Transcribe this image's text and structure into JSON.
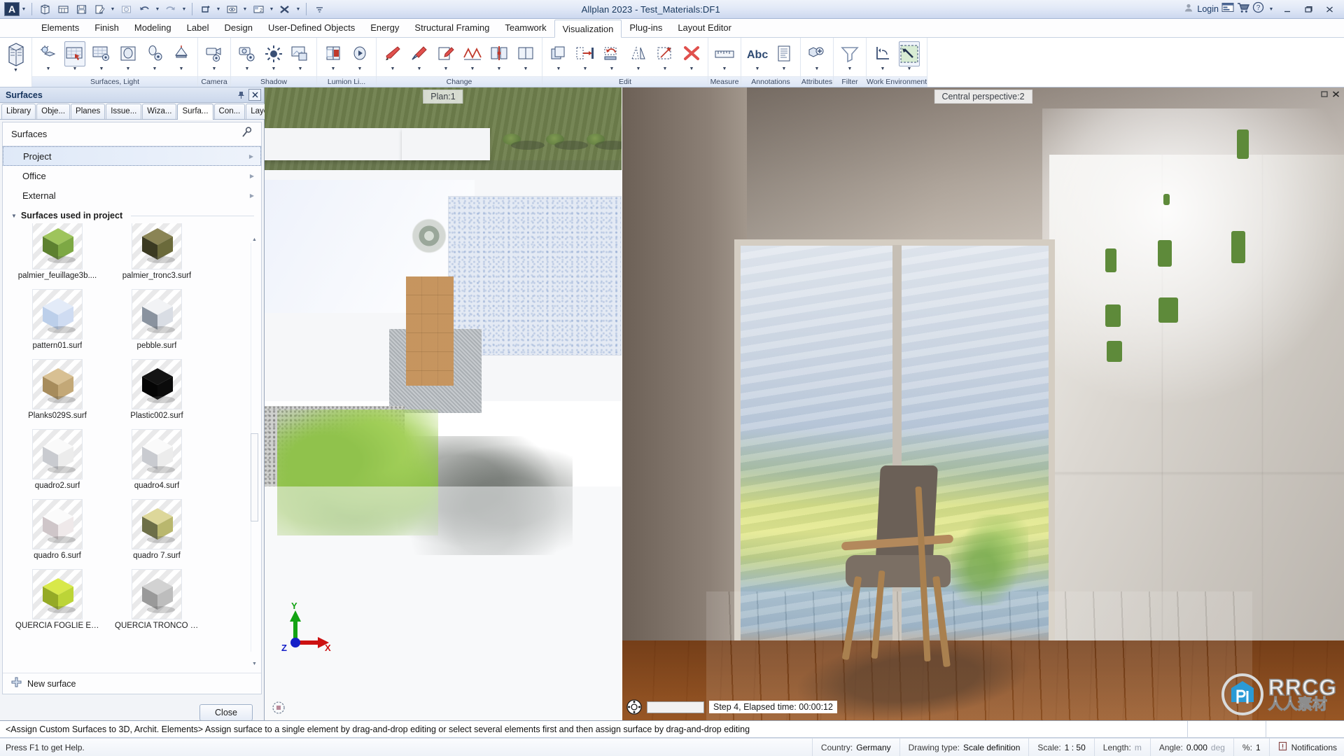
{
  "titlebar": {
    "logo": "A",
    "app_title": "Allplan 2023 - Test_Materials:DF1",
    "login_label": "Login",
    "icons": [
      "app-logo-icon",
      "new-icon",
      "table-icon",
      "save-icon",
      "edit-icon",
      "open-icon",
      "undo-icon",
      "redo-icon",
      "refresh-icon",
      "view-icon",
      "layout-icon",
      "tools-icon",
      "more-icon"
    ],
    "right_icons": [
      "login-icon",
      "connect-icon",
      "cart-icon",
      "help-icon"
    ],
    "window_buttons": [
      "minimize",
      "restore",
      "close"
    ]
  },
  "menu": {
    "items": [
      {
        "label": "Elements",
        "active": false
      },
      {
        "label": "Finish",
        "active": false
      },
      {
        "label": "Modeling",
        "active": false
      },
      {
        "label": "Label",
        "active": false
      },
      {
        "label": "Design",
        "active": false
      },
      {
        "label": "User-Defined Objects",
        "active": false
      },
      {
        "label": "Energy",
        "active": false
      },
      {
        "label": "Structural Framing",
        "active": false
      },
      {
        "label": "Teamwork",
        "active": false
      },
      {
        "label": "Visualization",
        "active": true
      },
      {
        "label": "Plug-ins",
        "active": false
      },
      {
        "label": "Layout Editor",
        "active": false
      }
    ]
  },
  "ribbon": {
    "groups": [
      {
        "label": "Surfaces, Light",
        "items": [
          "light-surface-icon",
          "assign-surface-icon",
          "surface-settings-icon",
          "light-sphere-icon",
          "lamp-settings-icon",
          "lamp-icon"
        ]
      },
      {
        "label": "Camera",
        "items": [
          "camera-settings-icon"
        ]
      },
      {
        "label": "Shadow",
        "items": [
          "shadow-camera-icon",
          "sun-icon",
          "shadow-image-icon"
        ]
      },
      {
        "label": "Lumion Li...",
        "items": [
          "lumion-export-icon",
          "lumion-play-icon"
        ]
      },
      {
        "label": "Change",
        "items": [
          "eraser-icon",
          "pipette-icon",
          "modify-icon",
          "polyline-icon",
          "mirror-icon",
          "section-icon"
        ]
      },
      {
        "label": "Edit",
        "items": [
          "copy-icon",
          "move-icon",
          "rotate-icon",
          "stretch-icon",
          "scale-icon",
          "delete-icon"
        ]
      },
      {
        "label": "Measure",
        "items": [
          "ruler-icon"
        ]
      },
      {
        "label": "Annotations",
        "items": [
          "text-abc-icon",
          "note-icon"
        ]
      },
      {
        "label": "Attributes",
        "items": [
          "attribute-tag-icon"
        ]
      },
      {
        "label": "Filter",
        "items": [
          "filter-funnel-icon"
        ]
      },
      {
        "label": "Work Environment",
        "items": [
          "coordinate-icon",
          "work-env-icon"
        ]
      }
    ]
  },
  "palette": {
    "title": "Surfaces",
    "pin_icon": "pin-icon",
    "close_icon": "close-icon",
    "tabs": [
      {
        "label": "Library",
        "active": false
      },
      {
        "label": "Obje...",
        "active": false
      },
      {
        "label": "Planes",
        "active": false
      },
      {
        "label": "Issue...",
        "active": false
      },
      {
        "label": "Wiza...",
        "active": false
      },
      {
        "label": "Surfa...",
        "active": true
      },
      {
        "label": "Con...",
        "active": false
      },
      {
        "label": "Layers",
        "active": false
      }
    ],
    "header_label": "Surfaces",
    "search_icon": "magnifier-icon",
    "tree": [
      {
        "label": "Project",
        "selected": true
      },
      {
        "label": "Office",
        "selected": false
      },
      {
        "label": "External",
        "selected": false
      }
    ],
    "section_title": "Surfaces used in project",
    "surfaces": [
      {
        "name": "palmier_feuillage3b....",
        "kind": "foliage"
      },
      {
        "name": "palmier_tronc3.surf",
        "kind": "bark"
      },
      {
        "name": "pattern01.surf",
        "kind": "pattern-light"
      },
      {
        "name": "pebble.surf",
        "kind": "pebble"
      },
      {
        "name": "Planks029S.surf",
        "kind": "wood"
      },
      {
        "name": "Plastic002.surf",
        "kind": "black"
      },
      {
        "name": "quadro2.surf",
        "kind": "white-art"
      },
      {
        "name": "quadro4.surf",
        "kind": "white-art"
      },
      {
        "name": "quadro 6.surf",
        "kind": "white-art2"
      },
      {
        "name": "quadro 7.surf",
        "kind": "collage"
      },
      {
        "name": "QUERCIA FOGLIE EU...",
        "kind": "leaves"
      },
      {
        "name": "QUERCIA TRONCO E...",
        "kind": "granite"
      }
    ],
    "new_surface_label": "New surface",
    "new_surface_icon": "plus-icon",
    "close_button": "Close"
  },
  "viewports": {
    "plan": {
      "label": "Plan:1",
      "axis": {
        "x": "X",
        "y": "Y",
        "z": "Z"
      },
      "compass_icon": "compass-icon"
    },
    "perspective": {
      "label": "Central perspective:2",
      "window_buttons": [
        "restore",
        "close"
      ],
      "render_status": "Step 4, Elapsed time: 00:00:12",
      "render_dial_icon": "render-dial-icon",
      "watermark_main": "RRCG",
      "watermark_sub": "人人素材"
    }
  },
  "command_bar": {
    "message": "<Assign Custom Surfaces to 3D, Archit. Elements> Assign surface to a single element by drag-and-drop editing or select several elements first and then assign surface by drag-and-drop editing"
  },
  "status_bar": {
    "help": "Press F1 to get Help.",
    "country_key": "Country:",
    "country_value": "Germany",
    "drawing_type_key": "Drawing type:",
    "drawing_type_value": "Scale definition",
    "scale_key": "Scale:",
    "scale_value": "1 : 50",
    "length_key": "Length:",
    "length_value": "m",
    "angle_key": "Angle:",
    "angle_value": "0.000",
    "angle_unit": "deg",
    "percent_key": "%:",
    "percent_value": "1",
    "notifications_label": "Notifications",
    "notifications_icon": "bell-icon"
  }
}
